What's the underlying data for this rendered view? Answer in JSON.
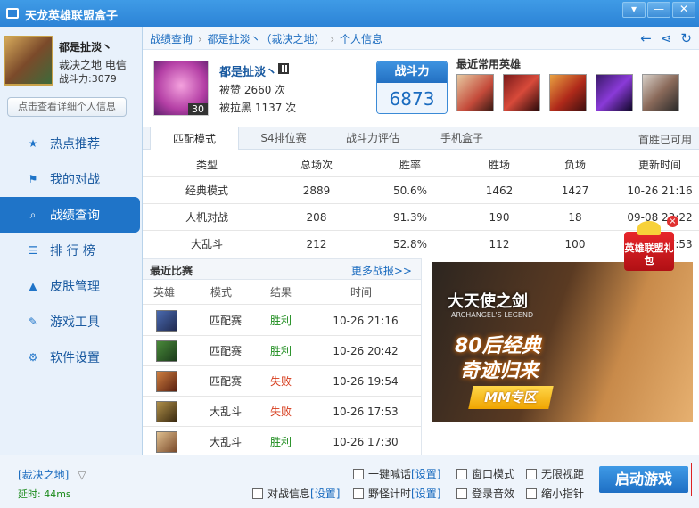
{
  "window": {
    "title": "天龙英雄联盟盒子",
    "controls": [
      "▾",
      "—",
      "✕"
    ]
  },
  "profile": {
    "name": "都是扯淡丶",
    "server_line": "裁决之地 电信",
    "power_line": "战斗力:3079",
    "detail_button": "点击查看详细个人信息"
  },
  "nav": {
    "items": [
      {
        "label": "热点推荐",
        "icon": "star-icon"
      },
      {
        "label": "我的对战",
        "icon": "battle-icon"
      },
      {
        "label": "战绩查询",
        "icon": "search-icon",
        "active": true
      },
      {
        "label": "排 行 榜",
        "icon": "list-icon"
      },
      {
        "label": "皮肤管理",
        "icon": "hat-icon"
      },
      {
        "label": "游戏工具",
        "icon": "wrench-icon"
      },
      {
        "label": "软件设置",
        "icon": "gear-icon"
      }
    ]
  },
  "breadcrumb": {
    "items": [
      "战绩查询",
      "都是扯淡丶（裁决之地）",
      "个人信息"
    ],
    "separator": "›"
  },
  "player": {
    "name": "都是扯淡丶",
    "level": "30",
    "praise": "被赞 2660 次",
    "blacklist": "被拉黑 1137 次",
    "power_label": "战斗力",
    "power_value": "6873",
    "fav_title": "最近常用英雄"
  },
  "tabs": {
    "items": [
      "匹配模式",
      "S4排位赛",
      "战斗力评估",
      "手机盒子"
    ],
    "right_note": "首胜已可用"
  },
  "stats": {
    "headers": [
      "类型",
      "总场次",
      "胜率",
      "胜场",
      "负场",
      "更新时间"
    ],
    "rows": [
      [
        "经典模式",
        "2889",
        "50.6%",
        "1462",
        "1427",
        "10-26 21:16"
      ],
      [
        "人机对战",
        "208",
        "91.3%",
        "190",
        "18",
        "09-08 23:22"
      ],
      [
        "大乱斗",
        "212",
        "52.8%",
        "112",
        "100",
        "10-26 17:53"
      ]
    ]
  },
  "recent": {
    "title": "最近比赛",
    "more": "更多战报>>",
    "headers": [
      "英雄",
      "模式",
      "结果",
      "时间"
    ],
    "rows": [
      {
        "mode": "匹配赛",
        "result": "胜利",
        "time": "10-26 21:16"
      },
      {
        "mode": "匹配赛",
        "result": "胜利",
        "time": "10-26 20:42"
      },
      {
        "mode": "匹配赛",
        "result": "失败",
        "time": "10-26 19:54"
      },
      {
        "mode": "大乱斗",
        "result": "失败",
        "time": "10-26 17:53"
      },
      {
        "mode": "大乱斗",
        "result": "胜利",
        "time": "10-26 17:30"
      }
    ]
  },
  "ad": {
    "logo": "大天使之剑",
    "logo_sub": "ARCHANGEL'S LEGEND",
    "line1": "80后经典",
    "line2": "奇迹归来",
    "button": "MM专区"
  },
  "gift": {
    "text": "英雄联盟礼包"
  },
  "bottom": {
    "server": "[裁决之地]",
    "delay": "延时: 44ms",
    "options": [
      {
        "label": "一键喊话",
        "set": "[设置]"
      },
      {
        "label": "窗口模式",
        "set": ""
      },
      {
        "label": "无限视距",
        "set": ""
      },
      {
        "label": "对战信息",
        "set": "[设置]"
      },
      {
        "label": "野怪计时",
        "set": "[设置]"
      },
      {
        "label": "登录音效",
        "set": ""
      },
      {
        "label": "缩小指针",
        "set": ""
      }
    ],
    "start_button": "启动游戏"
  }
}
